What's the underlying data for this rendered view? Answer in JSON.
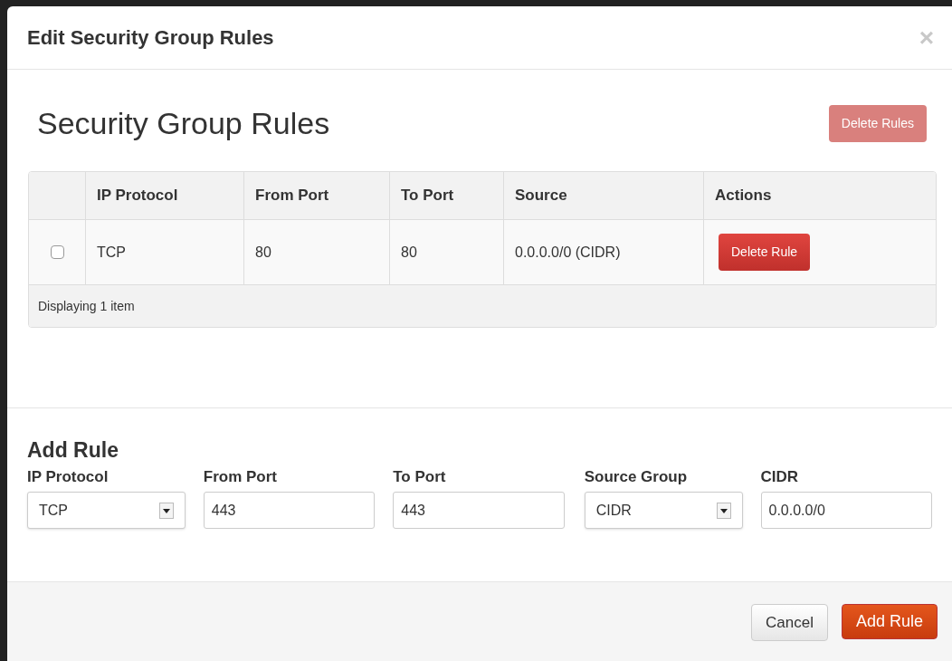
{
  "dialog": {
    "title": "Edit Security Group Rules",
    "close": "×"
  },
  "rules": {
    "heading": "Security Group Rules",
    "delete_button": {
      "label": "Delete Rules",
      "disabled": true
    },
    "table": {
      "columns": [
        "IP Protocol",
        "From Port",
        "To Port",
        "Source",
        "Actions"
      ],
      "rows": [
        {
          "checked": false,
          "cells": [
            "TCP",
            "80",
            "80",
            "0.0.0.0/0 (CIDR)"
          ],
          "action": "Delete Rule"
        }
      ],
      "footer": "Displaying 1 item"
    }
  },
  "add_rule": {
    "heading": "Add Rule",
    "fields": [
      {
        "kind": "select",
        "label": "IP Protocol",
        "value": "TCP"
      },
      {
        "kind": "input",
        "label": "From Port",
        "value": "443"
      },
      {
        "kind": "input",
        "label": "To Port",
        "value": "443"
      },
      {
        "kind": "select",
        "label": "Source Group",
        "value": "CIDR"
      },
      {
        "kind": "input",
        "label": "CIDR",
        "value": "0.0.0.0/0"
      }
    ]
  },
  "buttons": [
    {
      "kind": "secondary",
      "label": "Cancel"
    },
    {
      "kind": "primary",
      "label": "Add Rule"
    }
  ]
}
